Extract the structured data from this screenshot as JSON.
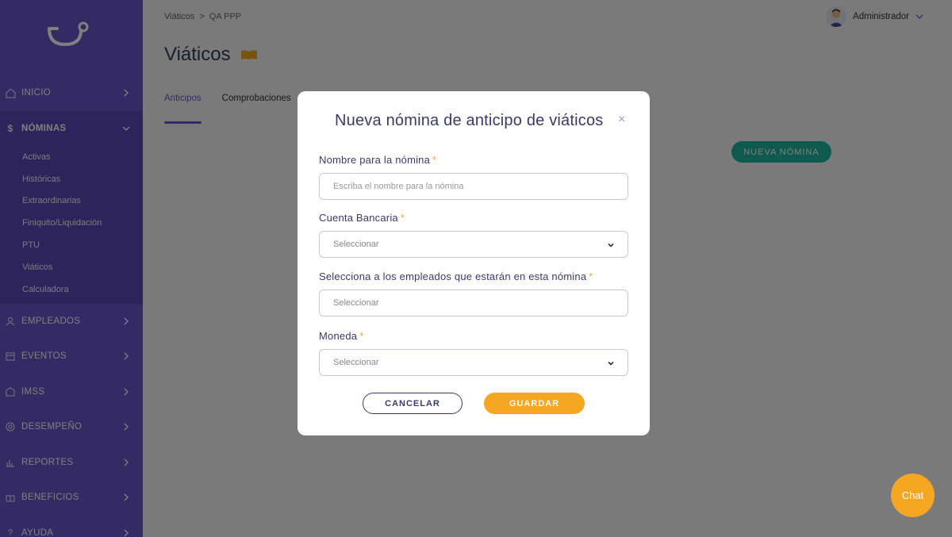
{
  "sidebar": {
    "items": [
      {
        "label": "INICIO",
        "icon": "home-icon"
      },
      {
        "label": "NÓMINAS",
        "icon": "dollar-icon",
        "expanded": true
      },
      {
        "label": "EMPLEADOS",
        "icon": "user-icon"
      },
      {
        "label": "EVENTOS",
        "icon": "calendar-icon"
      },
      {
        "label": "IMSS",
        "icon": "hospital-icon"
      },
      {
        "label": "DESEMPEÑO",
        "icon": "target-icon"
      },
      {
        "label": "REPORTES",
        "icon": "bar-chart-icon"
      },
      {
        "label": "BENEFICIOS",
        "icon": "gift-icon"
      },
      {
        "label": "AYUDA",
        "icon": "help-icon"
      }
    ],
    "submenu": [
      "Activas",
      "Históricas",
      "Extraordinarias",
      "Finiquito/Liquidación",
      "PTU",
      "Viáticos",
      "Calculadora"
    ]
  },
  "breadcrumb": {
    "first": "Viáticos",
    "sep": ">",
    "second": "QA PPP"
  },
  "page": {
    "title": "Viáticos"
  },
  "user": {
    "name": "Administrador"
  },
  "tabs": [
    "Anticipos",
    "Comprobaciones"
  ],
  "main": {
    "new_button": "NUEVA NÓMINA"
  },
  "modal": {
    "title": "Nueva nómina de anticipo de viáticos",
    "close": "×",
    "fields": {
      "name": {
        "label": "Nombre para la nómina",
        "required": "*",
        "placeholder": "Escriba el nombre para la nómina"
      },
      "bank": {
        "label": "Cuenta Bancaria",
        "required": "*",
        "value": "Seleccionar"
      },
      "employees": {
        "label": "Selecciona a los empleados que estarán en esta nómina",
        "required": "*",
        "value": "Seleccionar"
      },
      "currency": {
        "label": "Moneda",
        "required": "*",
        "value": "Seleccionar"
      }
    },
    "cancel": "CANCELAR",
    "save": "GUARDAR"
  },
  "chat": {
    "label": "Chat"
  },
  "colors": {
    "sidebar": "#6a56c9",
    "accent": "#f5a623",
    "teal": "#1fb49e"
  }
}
